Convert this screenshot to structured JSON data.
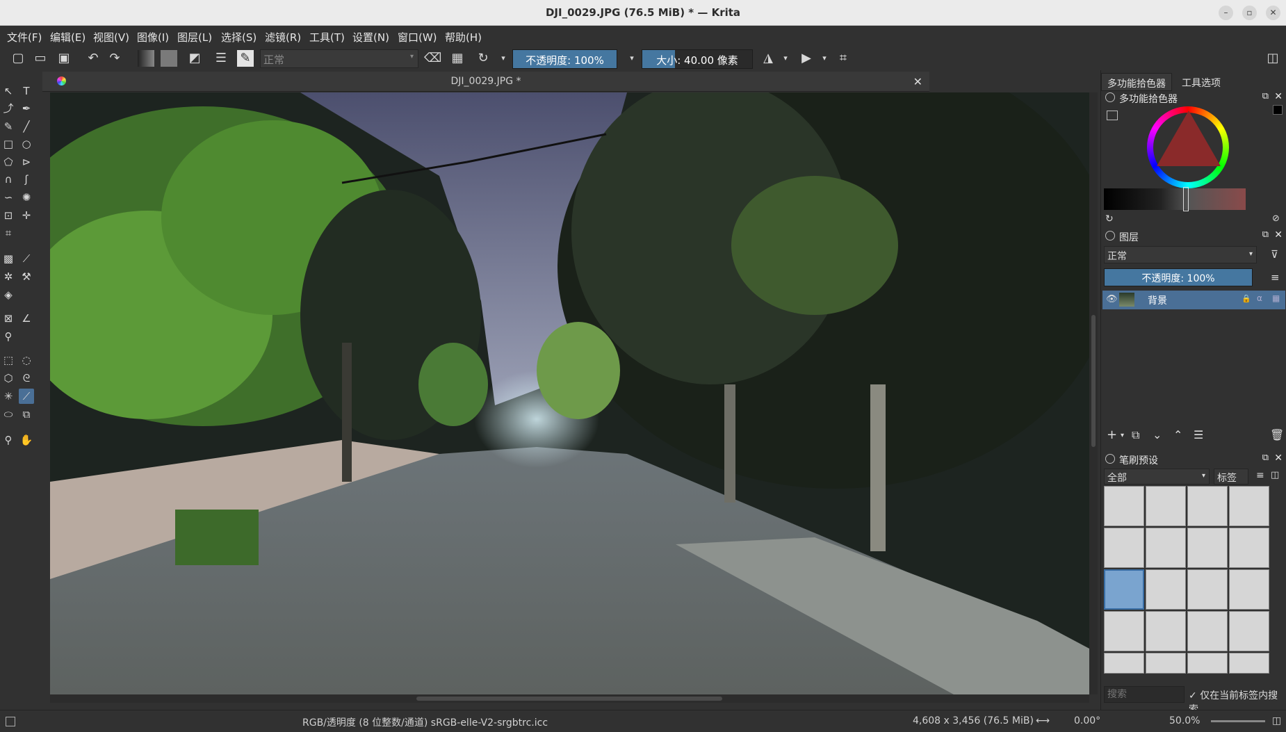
{
  "window": {
    "title": "DJI_0029.JPG (76.5 MiB)  * — Krita"
  },
  "menu": [
    "文件(F)",
    "编辑(E)",
    "视图(V)",
    "图像(I)",
    "图层(L)",
    "选择(S)",
    "滤镜(R)",
    "工具(T)",
    "设置(N)",
    "窗口(W)",
    "帮助(H)"
  ],
  "toolbar": {
    "blend_mode": "正常",
    "opacity_label": "不透明度: 100%",
    "opacity_value": 1.0,
    "size_label": "大小: 40.00 像素",
    "size_fill": 0.3
  },
  "document": {
    "tab_title": "DJI_0029.JPG *"
  },
  "right_panel": {
    "tabs": [
      "多功能拾色器",
      "工具选项"
    ],
    "color_selector": {
      "title": "多功能拾色器"
    },
    "layers": {
      "title": "图层",
      "blend_mode": "正常",
      "opacity_label": "不透明度: 100%",
      "items": [
        {
          "name": "背景"
        }
      ]
    },
    "brush_presets": {
      "title": "笔刷预设",
      "filter": "全部",
      "tag_label": "标签",
      "search_placeholder": "搜索",
      "only_tag_label": "仅在当前标签内搜索"
    }
  },
  "status": {
    "colorspace": "RGB/透明度 (8 位整数/通道)  sRGB-elle-V2-srgbtrc.icc",
    "dimensions": "4,608 x 3,456 (76.5 MiB)",
    "rotation": "0.00°",
    "zoom": "50.0%"
  },
  "colors": {
    "accent": "#4577a0",
    "panel_bg": "#313131",
    "selected_layer": "#4a6f96"
  }
}
